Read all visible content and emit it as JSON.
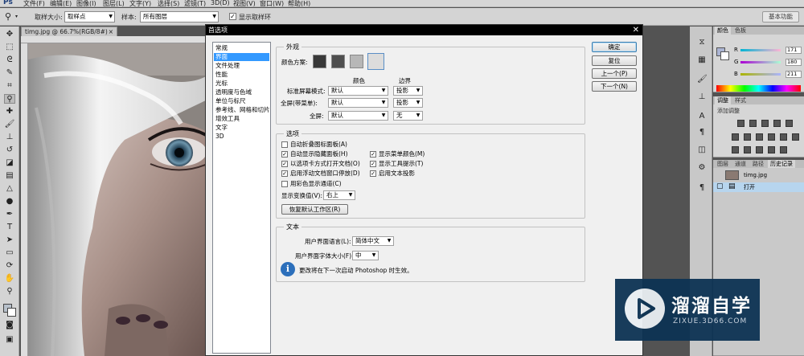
{
  "app": {
    "logo": "Ps",
    "menu": [
      "文件(F)",
      "编辑(E)",
      "图像(I)",
      "图层(L)",
      "文字(Y)",
      "选择(S)",
      "滤镜(T)",
      "3D(D)",
      "视图(V)",
      "窗口(W)",
      "帮助(H)"
    ]
  },
  "options_bar": {
    "sample_size_label": "取样大小:",
    "sample_size_value": "取样点",
    "sample_label": "样本:",
    "sample_value": "所有图层",
    "show_ring_label": "显示取样环",
    "show_ring_checked": true,
    "workspace_button": "基本功能"
  },
  "document": {
    "tab_label": "timg.jpg @ 66.7%(RGB/8#)"
  },
  "dialog": {
    "title": "首选项",
    "close": "✕",
    "nav_items": [
      "常规",
      "界面",
      "文件处理",
      "性能",
      "光标",
      "透明度与色域",
      "单位与标尺",
      "参考线、网格和切片",
      "增效工具",
      "文字",
      "3D"
    ],
    "nav_selected_index": 1,
    "buttons": {
      "ok": "确定",
      "reset": "复位",
      "prev": "上一个(P)",
      "next": "下一个(N)"
    },
    "appearance": {
      "group_title": "外观",
      "color_scheme_label": "颜色方案:",
      "col_color": "颜色",
      "col_border": "边界",
      "rows": [
        {
          "label": "标准屏幕模式:",
          "color": "默认",
          "border": "投影"
        },
        {
          "label": "全屏(带菜单):",
          "color": "默认",
          "border": "投影"
        },
        {
          "label": "全屏:",
          "color": "默认",
          "border": "无"
        }
      ],
      "schemes": [
        "#393939",
        "#4f4f4f",
        "#b7b7b7",
        "#dcdcdc"
      ]
    },
    "options": {
      "group_title": "选项",
      "checks_left": [
        {
          "label": "自动折叠图标面板(A)",
          "checked": false
        },
        {
          "label": "自动显示隐藏面板(H)",
          "checked": true
        },
        {
          "label": "以选项卡方式打开文档(O)",
          "checked": true
        },
        {
          "label": "启用浮动文档窗口停放(D)",
          "checked": true
        },
        {
          "label": "用彩色显示通道(C)",
          "checked": false
        }
      ],
      "checks_right": [
        {
          "label": "显示菜单颜色(M)",
          "checked": true
        },
        {
          "label": "显示工具提示(T)",
          "checked": true
        },
        {
          "label": "启用文本投影",
          "checked": true
        }
      ],
      "transform_label": "显示变换值(V):",
      "transform_value": "右上",
      "restore_button": "恢复默认工作区(R)"
    },
    "text": {
      "group_title": "文本",
      "ui_lang_label": "用户界面语言(L):",
      "ui_lang_value": "简体中文",
      "ui_font_label": "用户界面字体大小(F):",
      "ui_font_value": "中",
      "info": "更改将在下一次启动 Photoshop 时生效。"
    }
  },
  "right_panels": {
    "color_tabs": [
      "颜色",
      "色板"
    ],
    "rgb": [
      {
        "channel": "R",
        "value": "171"
      },
      {
        "channel": "G",
        "value": "180"
      },
      {
        "channel": "B",
        "value": "211"
      }
    ],
    "adjust_tabs": [
      "调整",
      "样式"
    ],
    "adjust_label": "添加调整",
    "layer_tabs": [
      "图层",
      "通道",
      "路径",
      "历史记录"
    ],
    "history": [
      {
        "label": "timg.jpg"
      },
      {
        "label": "打开"
      }
    ]
  },
  "watermark": {
    "title": "溜溜自学",
    "url": "ZIXUE.3D66.COM"
  }
}
